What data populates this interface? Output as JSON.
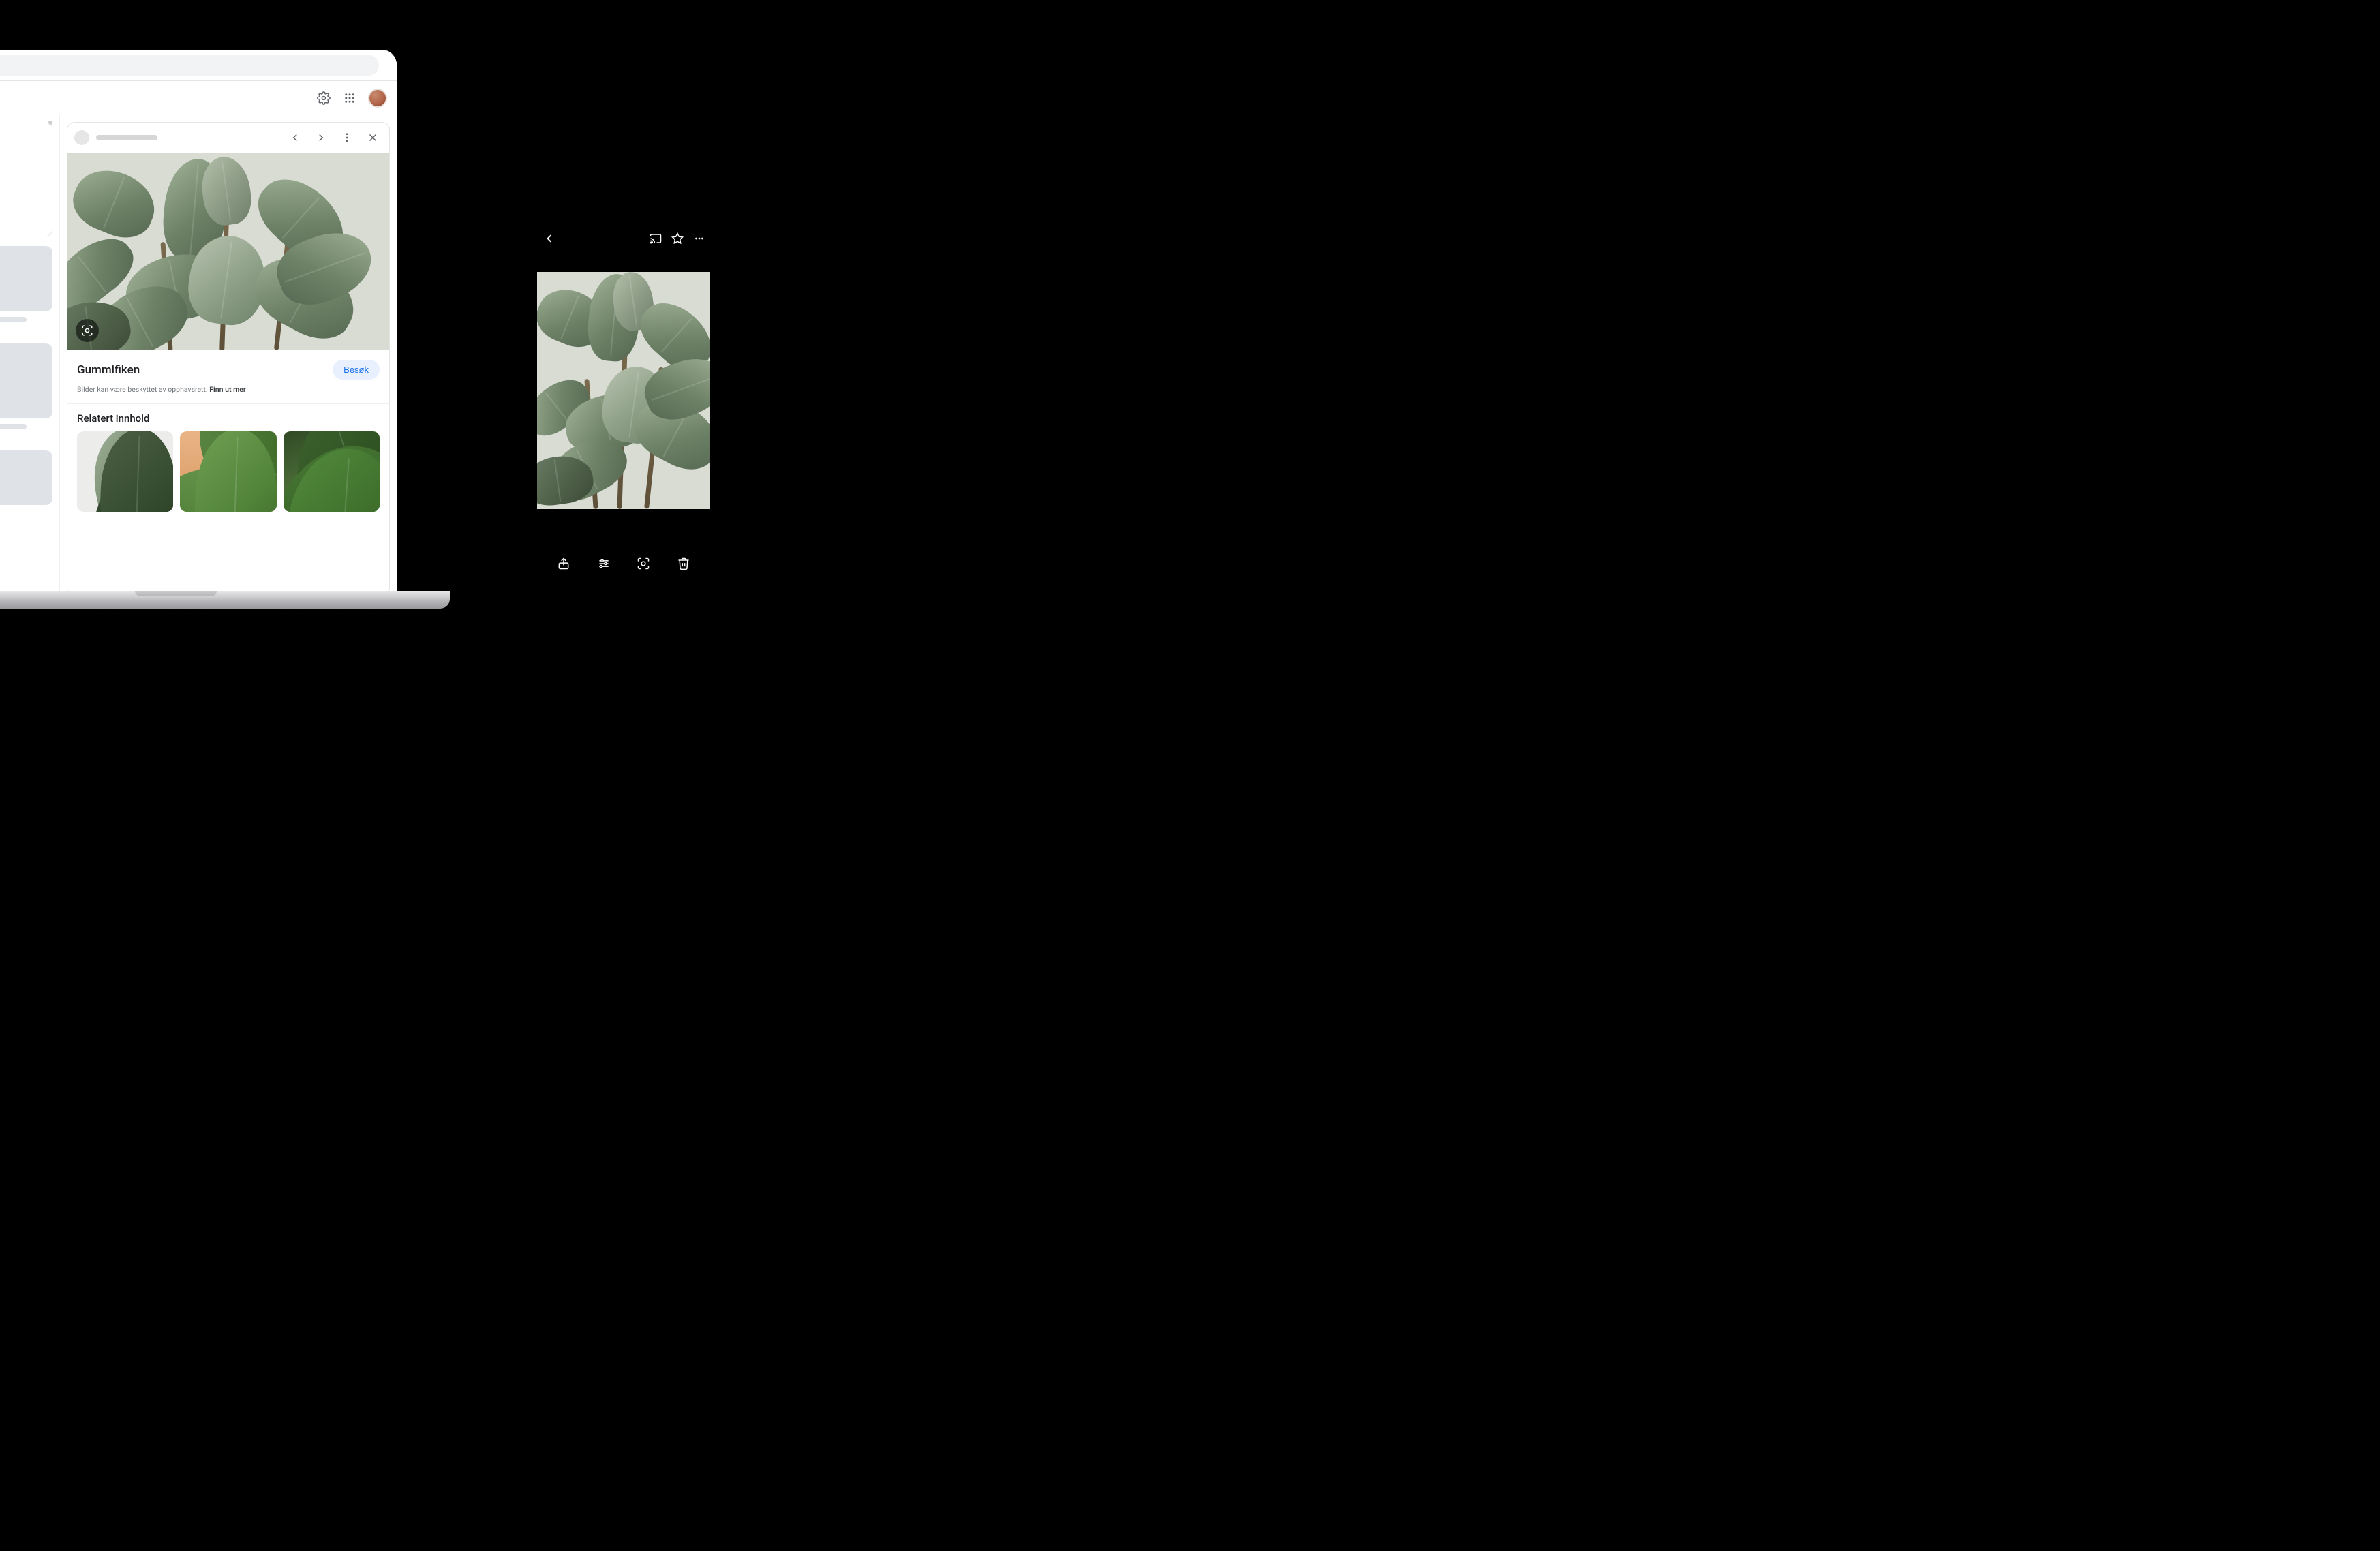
{
  "laptop": {
    "topbar": {
      "settings_icon": "settings-icon",
      "apps_icon": "apps-grid-icon",
      "avatar": "profile-avatar"
    },
    "panel": {
      "title": "Gummifiken",
      "visit_label": "Besøk",
      "copyright_text": "Bilder kan være beskyttet av opphavsrett.",
      "copyright_link": "Finn ut mer",
      "related_heading": "Relatert innhold",
      "nav": {
        "prev": "previous",
        "next": "next",
        "more": "more",
        "close": "close"
      },
      "lens_icon": "lens-icon"
    }
  },
  "phone": {
    "top": {
      "back": "back",
      "cast": "cast",
      "star": "star",
      "more": "more"
    },
    "bottom": {
      "share": "share",
      "tune": "tune",
      "lens": "lens",
      "trash": "trash"
    }
  }
}
